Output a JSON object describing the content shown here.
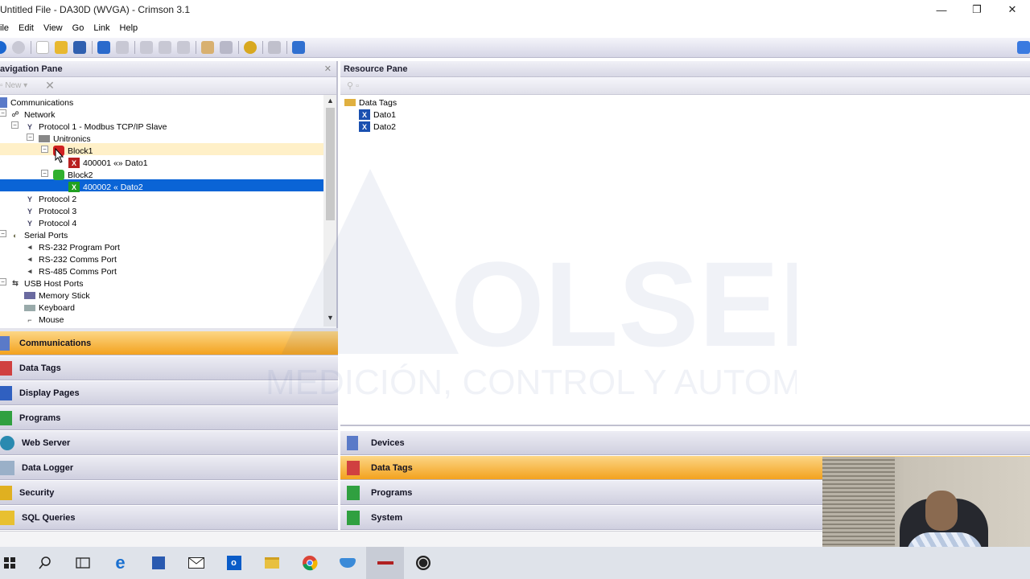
{
  "window": {
    "title": "Untitled File - DA30D (WVGA) - Crimson 3.1",
    "minimize": "—",
    "restore": "❐",
    "close": "✕"
  },
  "menu": {
    "items": [
      "ile",
      "Edit",
      "View",
      "Go",
      "Link",
      "Help"
    ]
  },
  "nav_pane": {
    "title": "avigation Pane",
    "new_label": "New",
    "tree": [
      {
        "label": "Communications",
        "icon": "comms-icon"
      },
      {
        "label": "Network",
        "icon": "network-icon"
      },
      {
        "label": "Protocol 1 - Modbus TCP/IP Slave",
        "icon": "protocol-icon"
      },
      {
        "label": "Unitronics",
        "icon": "device-icon"
      },
      {
        "label": "Block1",
        "icon": "block-red-icon"
      },
      {
        "label": "400001 «» Dato1",
        "icon": "tag-red-icon"
      },
      {
        "label": "Block2",
        "icon": "block-green-icon"
      },
      {
        "label": "400002 « Dato2",
        "icon": "tag-green-icon"
      },
      {
        "label": "Protocol 2",
        "icon": "protocol-icon"
      },
      {
        "label": "Protocol 3",
        "icon": "protocol-icon"
      },
      {
        "label": "Protocol 4",
        "icon": "protocol-icon"
      },
      {
        "label": "Serial Ports",
        "icon": "serial-icon"
      },
      {
        "label": "RS-232 Program Port",
        "icon": "port-icon"
      },
      {
        "label": "RS-232 Comms Port",
        "icon": "port-icon"
      },
      {
        "label": "RS-485 Comms Port",
        "icon": "port-icon"
      },
      {
        "label": "USB Host Ports",
        "icon": "usb-icon"
      },
      {
        "label": "Memory Stick",
        "icon": "memory-icon"
      },
      {
        "label": "Keyboard",
        "icon": "keyboard-icon"
      },
      {
        "label": "Mouse",
        "icon": "mouse-icon"
      }
    ],
    "categories": [
      "Communications",
      "Data Tags",
      "Display Pages",
      "Programs",
      "Web Server",
      "Data Logger",
      "Security",
      "SQL Queries"
    ],
    "active_category": "Communications"
  },
  "resource_pane": {
    "title": "Resource Pane",
    "tree": [
      {
        "label": "Data Tags",
        "icon": "folder-icon"
      },
      {
        "label": "Dato1",
        "icon": "tag-blue-icon"
      },
      {
        "label": "Dato2",
        "icon": "tag-blue-icon"
      }
    ],
    "categories": [
      "Devices",
      "Data Tags",
      "Programs",
      "System"
    ],
    "active_category": "Data Tags"
  },
  "watermark": {
    "brand": "OLSEIN",
    "tagline": "MEDICIÓN, CONTROL Y AUTOMATIZACIÓN"
  },
  "colors": {
    "accent_orange": "#f3a21e",
    "selection_blue": "#0a64d6",
    "hover_yellow": "#fff0c8"
  }
}
